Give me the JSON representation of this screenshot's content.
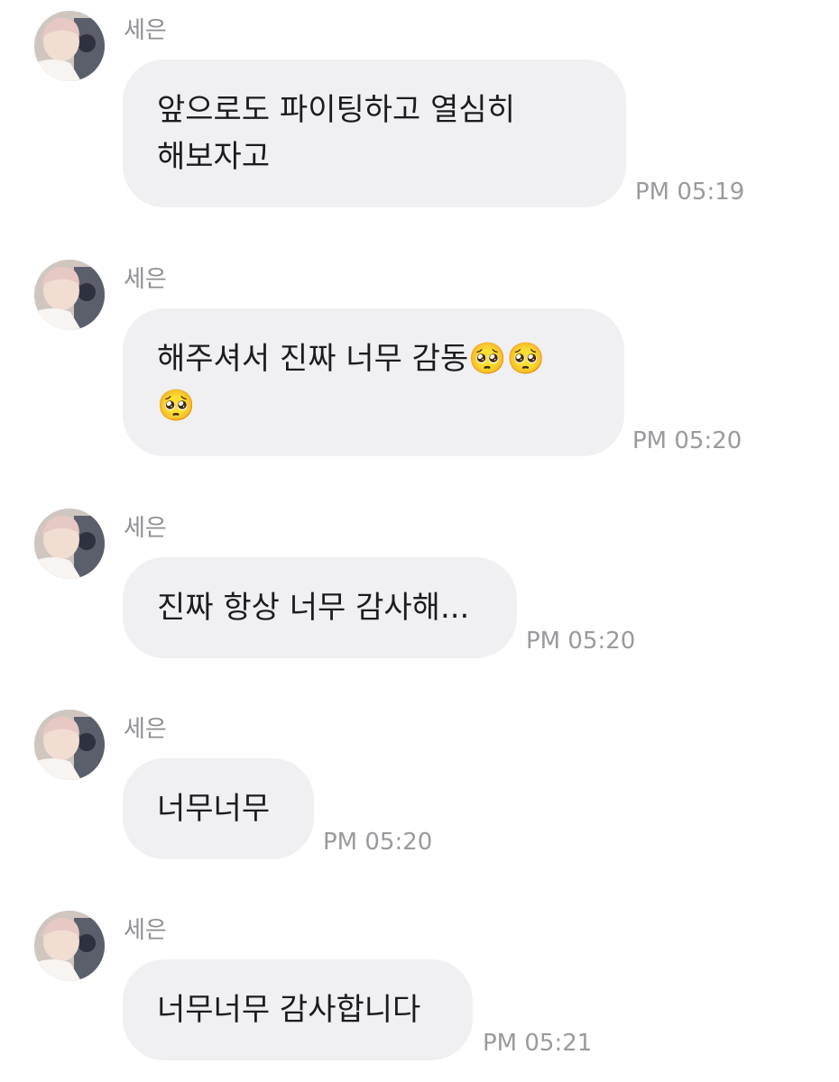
{
  "messages": [
    {
      "sender": "세은",
      "text": "앞으로도 파이팅하고 열심히\n해보자고",
      "time": "PM 05:19"
    },
    {
      "sender": "세은",
      "text": "해주셔서 진짜 너무 감동🥺🥺\n🥺",
      "time": "PM 05:20"
    },
    {
      "sender": "세은",
      "text": "진짜 항상 너무 감사해...",
      "time": "PM 05:20"
    },
    {
      "sender": "세은",
      "text": "너무너무",
      "time": "PM 05:20"
    },
    {
      "sender": "세은",
      "text": "너무너무 감사합니다",
      "time": "PM 05:21"
    }
  ],
  "colors": {
    "bubble": "#f0f0f2",
    "text": "#1c1c1e",
    "meta": "#8e8e93"
  },
  "icons": {
    "avatar": "profile-photo"
  }
}
